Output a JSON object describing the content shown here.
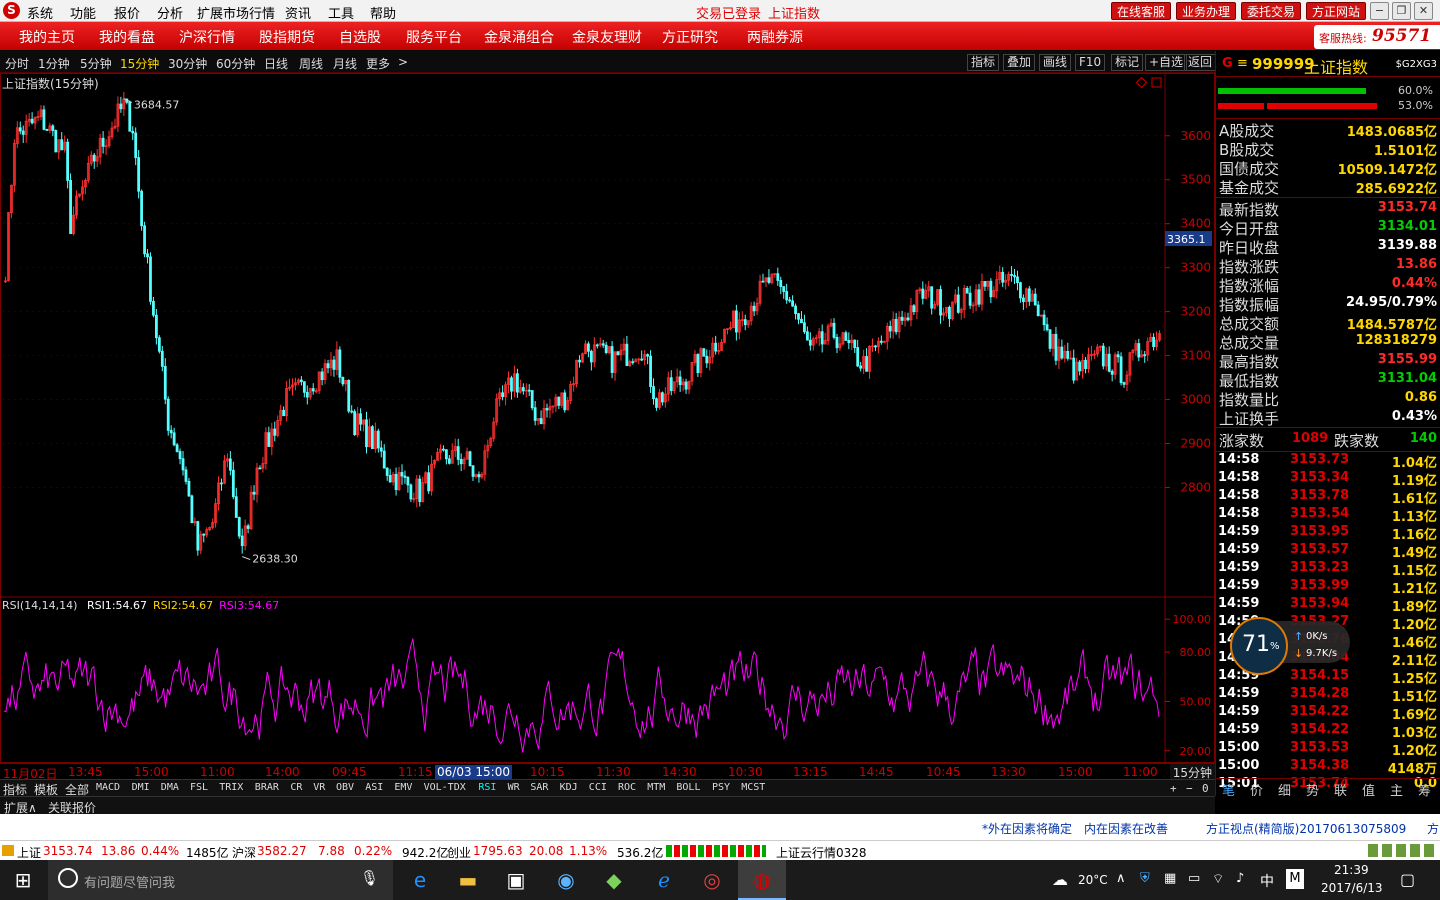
{
  "menubar": {
    "items": [
      "系统",
      "功能",
      "报价",
      "分析",
      "扩展市场行情",
      "资讯",
      "工具",
      "帮助"
    ],
    "status_login": "交易已登录",
    "status_index": "上证指数",
    "buttons": [
      "在线客服",
      "业务办理",
      "委托交易",
      "方正网站"
    ]
  },
  "navbar": {
    "items": [
      "我的主页",
      "我的看盘",
      "沪深行情",
      "股指期货",
      "自选股",
      "服务平台",
      "金泉涌组合",
      "金泉友理财",
      "方正研究",
      "两融券源"
    ],
    "hotline_label": "客服热线:",
    "hotline_number": "95571"
  },
  "periods": {
    "items": [
      "分时",
      "1分钟",
      "5分钟",
      "15分钟",
      "30分钟",
      "60分钟",
      "日线",
      "周线",
      "月线",
      "更多"
    ],
    "active": "15分钟",
    "more_arrow": ">",
    "tools": [
      "指标",
      "叠加",
      "画线",
      "F10",
      "标记",
      "+自选",
      "返回"
    ]
  },
  "chart_data": [
    {
      "type": "candlestick",
      "title": "上证指数(15分钟)",
      "ylim": [
        2560,
        3720
      ],
      "y_ticks": [
        3600,
        3500,
        3400,
        3300,
        3200,
        3100,
        3000,
        2900,
        2800
      ],
      "current_price_label": "3365.1",
      "high_annotation": "3684.57",
      "low_annotation": "2638.30",
      "key_points": [
        {
          "i": 0,
          "v": 3300
        },
        {
          "i": 3,
          "v": 3600
        },
        {
          "i": 12,
          "v": 3640
        },
        {
          "i": 20,
          "v": 3560
        },
        {
          "i": 22,
          "v": 3400
        },
        {
          "i": 30,
          "v": 3550
        },
        {
          "i": 40,
          "v": 3670
        },
        {
          "i": 43,
          "v": 3620
        },
        {
          "i": 46,
          "v": 3400
        },
        {
          "i": 50,
          "v": 3200
        },
        {
          "i": 55,
          "v": 2950
        },
        {
          "i": 60,
          "v": 2850
        },
        {
          "i": 65,
          "v": 2660
        },
        {
          "i": 70,
          "v": 2720
        },
        {
          "i": 75,
          "v": 2880
        },
        {
          "i": 80,
          "v": 2650
        },
        {
          "i": 85,
          "v": 2850
        },
        {
          "i": 95,
          "v": 3000
        },
        {
          "i": 105,
          "v": 3050
        },
        {
          "i": 112,
          "v": 3090
        },
        {
          "i": 118,
          "v": 2950
        },
        {
          "i": 125,
          "v": 2900
        },
        {
          "i": 130,
          "v": 2830
        },
        {
          "i": 140,
          "v": 2790
        },
        {
          "i": 148,
          "v": 2870
        },
        {
          "i": 155,
          "v": 2870
        },
        {
          "i": 160,
          "v": 2810
        },
        {
          "i": 165,
          "v": 2960
        },
        {
          "i": 172,
          "v": 3050
        },
        {
          "i": 180,
          "v": 2960
        },
        {
          "i": 190,
          "v": 3010
        },
        {
          "i": 195,
          "v": 3120
        },
        {
          "i": 205,
          "v": 3090
        },
        {
          "i": 215,
          "v": 3120
        },
        {
          "i": 220,
          "v": 3000
        },
        {
          "i": 230,
          "v": 3050
        },
        {
          "i": 240,
          "v": 3130
        },
        {
          "i": 250,
          "v": 3200
        },
        {
          "i": 258,
          "v": 3270
        },
        {
          "i": 265,
          "v": 3230
        },
        {
          "i": 272,
          "v": 3110
        },
        {
          "i": 280,
          "v": 3150
        },
        {
          "i": 290,
          "v": 3080
        },
        {
          "i": 300,
          "v": 3160
        },
        {
          "i": 310,
          "v": 3240
        },
        {
          "i": 320,
          "v": 3210
        },
        {
          "i": 330,
          "v": 3250
        },
        {
          "i": 340,
          "v": 3270
        },
        {
          "i": 348,
          "v": 3230
        },
        {
          "i": 352,
          "v": 3140
        },
        {
          "i": 362,
          "v": 3060
        },
        {
          "i": 370,
          "v": 3100
        },
        {
          "i": 378,
          "v": 3060
        },
        {
          "i": 385,
          "v": 3130
        },
        {
          "i": 390,
          "v": 3150
        }
      ]
    },
    {
      "type": "line",
      "title": "RSI(14,14,14)",
      "series": [
        {
          "name": "RSI1",
          "value": "54.67",
          "color": "#ffffff"
        },
        {
          "name": "RSI2",
          "value": "54.67",
          "color": "#ffd700"
        },
        {
          "name": "RSI3",
          "value": "54.67",
          "color": "#ff00ff"
        }
      ],
      "ylim": [
        15,
        105
      ],
      "y_ticks": [
        "100.00",
        "80.00",
        "50.00",
        "20.00"
      ]
    }
  ],
  "time_axis": {
    "labels": [
      "11月02日",
      "13:45",
      "15:00",
      "11:00",
      "14:00",
      "09:45",
      "11:15",
      "06/03 15:00",
      "10:15",
      "11:30",
      "14:30",
      "10:30",
      "13:15",
      "14:45",
      "10:45",
      "13:30",
      "15:00",
      "11:00"
    ],
    "period_tag": "15分钟"
  },
  "indicators": [
    "指标",
    "模板",
    "全部",
    "MACD",
    "DMI",
    "DMA",
    "FSL",
    "TRIX",
    "BRAR",
    "CR",
    "VR",
    "OBV",
    "ASI",
    "EMV",
    "VOL-TDX",
    "RSI",
    "WR",
    "SAR",
    "KDJ",
    "CCI",
    "ROC",
    "MTM",
    "BOLL",
    "PSY",
    "MCST"
  ],
  "indicator_active": "RSI",
  "indicator_controls": [
    "+",
    "−",
    "0"
  ],
  "bottom_tabs": [
    "扩展∧",
    "关联报价"
  ],
  "right_panel": {
    "code": "999999",
    "name": "上证指数",
    "tag": "$G2XG3",
    "g_mark": "G",
    "menu_mark": "≡",
    "bar1_pct": "60.0%",
    "bar2_pct": "53.0%",
    "volumes": [
      {
        "k": "A股成交",
        "v": "1483.0685亿"
      },
      {
        "k": "B股成交",
        "v": "1.5101亿"
      },
      {
        "k": "国债成交",
        "v": "10509.1472亿"
      },
      {
        "k": "基金成交",
        "v": "285.6922亿"
      }
    ],
    "stats": [
      {
        "k": "最新指数",
        "v": "3153.74",
        "c": "red"
      },
      {
        "k": "今日开盘",
        "v": "3134.01",
        "c": "grn"
      },
      {
        "k": "昨日收盘",
        "v": "3139.88",
        "c": "wht"
      },
      {
        "k": "指数涨跌",
        "v": "13.86",
        "c": "red"
      },
      {
        "k": "指数涨幅",
        "v": "0.44%",
        "c": "red"
      },
      {
        "k": "指数振幅",
        "v": "24.95/0.79%",
        "c": "wht"
      },
      {
        "k": "总成交额",
        "v": "1484.5787亿",
        "c": "yel"
      },
      {
        "k": "总成交量",
        "v": "128318279",
        "c": "yel"
      },
      {
        "k": "最高指数",
        "v": "3155.99",
        "c": "red"
      },
      {
        "k": "最低指数",
        "v": "3131.04",
        "c": "grn"
      },
      {
        "k": "指数量比",
        "v": "0.86",
        "c": "yel"
      },
      {
        "k": "上证换手",
        "v": "0.43%",
        "c": "wht"
      }
    ],
    "up_label": "涨家数",
    "up_count": "1089",
    "down_label": "跌家数",
    "down_count": "140",
    "ticks": [
      {
        "t": "14:58",
        "p": "3153.73",
        "a": "1.04亿"
      },
      {
        "t": "14:58",
        "p": "3153.34",
        "a": "1.19亿"
      },
      {
        "t": "14:58",
        "p": "3153.78",
        "a": "1.61亿"
      },
      {
        "t": "14:58",
        "p": "3153.54",
        "a": "1.13亿"
      },
      {
        "t": "14:59",
        "p": "3153.95",
        "a": "1.16亿"
      },
      {
        "t": "14:59",
        "p": "3153.57",
        "a": "1.49亿"
      },
      {
        "t": "14:59",
        "p": "3153.23",
        "a": "1.15亿"
      },
      {
        "t": "14:59",
        "p": "3153.99",
        "a": "1.21亿"
      },
      {
        "t": "14:59",
        "p": "3153.94",
        "a": "1.89亿"
      },
      {
        "t": "14:59",
        "p": "3153.27",
        "a": "1.20亿"
      },
      {
        "t": "14:59",
        "p": "3153.76",
        "a": "1.46亿"
      },
      {
        "t": "14:59",
        "p": "3153.84",
        "a": "2.11亿"
      },
      {
        "t": "14:59",
        "p": "3154.15",
        "a": "1.25亿"
      },
      {
        "t": "14:59",
        "p": "3154.28",
        "a": "1.51亿"
      },
      {
        "t": "14:59",
        "p": "3154.22",
        "a": "1.69亿"
      },
      {
        "t": "14:59",
        "p": "3154.22",
        "a": "1.03亿"
      },
      {
        "t": "15:00",
        "p": "3153.53",
        "a": "1.20亿"
      },
      {
        "t": "15:00",
        "p": "3154.38",
        "a": "4148万"
      },
      {
        "t": "15:01",
        "p": "3153.74",
        "a": "0.0"
      }
    ],
    "tabs": [
      "笔",
      "价",
      "细",
      "势",
      "联",
      "值",
      "主",
      "筹"
    ]
  },
  "net_widget": {
    "percent": "71",
    "percent_sign": "%",
    "up": "0K/s",
    "down": "9.7K/s"
  },
  "status": {
    "msg1": "*外在因素将确定",
    "msg2": "内在因素在改善",
    "msg3": "方正视点(精简版)20170613075809",
    "msg4": "方"
  },
  "market": {
    "sh_label": "上证",
    "sh_val": "3153.74",
    "sh_chg": "13.86",
    "sh_pct": "0.44%",
    "sh_amt": "1485亿",
    "sz_label": "沪深",
    "sz_val": "3582.27",
    "sz_chg": "7.88",
    "sz_pct": "0.22%",
    "sz_amt": "942.2亿",
    "cy_label": "创业",
    "cy_val": "1795.63",
    "cy_chg": "20.08",
    "cy_pct": "1.13%",
    "cy_amt": "536.2亿",
    "cloud": "上证云行情0328"
  },
  "taskbar": {
    "search_placeholder": "有问题尽管问我",
    "weather": "20°C",
    "ime": "中",
    "ime2": "M",
    "time": "21:39",
    "date": "2017/6/13"
  }
}
